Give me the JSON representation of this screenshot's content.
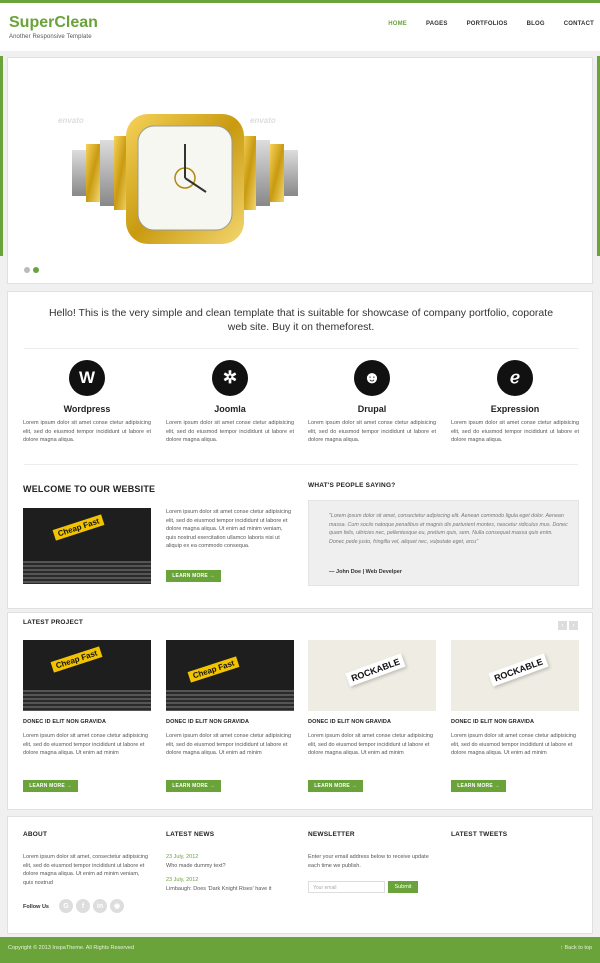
{
  "header": {
    "logo_title": "SuperClean",
    "logo_tagline": "Another Responsive Template",
    "nav": [
      "HOME",
      "PAGES",
      "PORTFOLIOS",
      "BLOG",
      "CONTACT"
    ]
  },
  "slider": {
    "watermarks": [
      "envato",
      "envato"
    ],
    "dots": 2,
    "active_dot": 1
  },
  "intro": "Hello! This is the very simple and clean template that is suitable for showcase of company portfolio, coporate web site. Buy it on themeforest.",
  "features": [
    {
      "title": "Wordpress",
      "icon": "wordpress-icon",
      "glyph": "W",
      "text": "Lorem ipsum dolor sit amet conse ctetur adipisicing elit, sed do eiusmod tempor incididunt ut labore et dolore magna aliqua."
    },
    {
      "title": "Joomla",
      "icon": "joomla-icon",
      "glyph": "✲",
      "text": "Lorem ipsum dolor sit amet conse ctetur adipisicing elit, sed do eiusmod tempor incididunt ut labore et dolore magna aliqua."
    },
    {
      "title": "Drupal",
      "icon": "drupal-icon",
      "glyph": "☻",
      "text": "Lorem ipsum dolor sit amet conse ctetur adipisicing elit, sed do eiusmod tempor incididunt ut labore et dolore magna aliqua."
    },
    {
      "title": "Expression",
      "icon": "expression-engine-icon",
      "glyph": "ℯ",
      "text": "Lorem ipsum dolor sit amet conse ctetur adipisicing elit, sed do eiusmod tempor incididunt ut labore et dolore magna aliqua."
    }
  ],
  "welcome": {
    "heading": "WELCOME TO OUR WEBSITE",
    "image_label": "Cheap Fast",
    "text": "Lorem ipsum dolor sit amet conse ctetur adipisicing elit, sed do eiusmod tempor incididunt ut labore et dolore magna aliqua. Ut enim ad minim veniam, quis nostrud exercitation ullamco laboris nisi ut aliquip ex ea commodo consequa.",
    "button": "LEARN MORE →"
  },
  "testimonial": {
    "heading": "WHAT'S PEOPLE SAYING?",
    "text": "\"Lorem ipsum dolor sit amet, consectetur adipiscing elit. Aenean commodo ligula eget dolor. Aenean massa. Cum sociis natoque penatibus et magnis dis parturient montes, nascetur ridiculus mus. Donec quam felis, ultricies nec, pellentesque eu, pretium quis, sem. Nulla consequat massa quis enim. Donec pede justo, fringilla vel, aliquet nec, vulputate eget, arcu\"",
    "author": "— John Doe | Web Develper"
  },
  "latest_project": {
    "heading": "LATEST PROJECT",
    "arrows": [
      "‹",
      "›"
    ],
    "items": [
      {
        "title": "DONEC ID ELIT NON GRAVIDA",
        "image": "book",
        "image_label": "Cheap Fast",
        "text": "Lorem ipsum dolor sit amet conse ctetur adipisicing elit, sed do eiusmod tempor incididunt ut labore et dolore magna aliqua. Ut enim ad minim",
        "button": "LEARN MORE →"
      },
      {
        "title": "DONEC ID ELIT NON GRAVIDA",
        "image": "book",
        "image_label": "Cheap Fast",
        "text": "Lorem ipsum dolor sit amet conse ctetur adipisicing elit, sed do eiusmod tempor incididunt ut labore et dolore magna aliqua. Ut enim ad minim",
        "button": "LEARN MORE →"
      },
      {
        "title": "DONEC ID ELIT NON GRAVIDA",
        "image": "card",
        "image_label": "ROCKABLE",
        "text": "Lorem ipsum dolor sit amet conse ctetur adipisicing elit, sed do eiusmod tempor incididunt ut labore et dolore magna aliqua. Ut enim ad minim",
        "button": "LEARN MORE →"
      },
      {
        "title": "DONEC ID ELIT NON GRAVIDA",
        "image": "card",
        "image_label": "ROCKABLE",
        "text": "Lorem ipsum dolor sit amet conse ctetur adipisicing elit, sed do eiusmod tempor incididunt ut labore et dolore magna aliqua. Ut enim ad minim",
        "button": "LEARN MORE →"
      }
    ]
  },
  "footer": {
    "about": {
      "heading": "ABOUT",
      "text": "Lorem ipsum dolor sit amet, consectetur adipisicing elit, sed do eiusmod tempor incididunt ut labore et dolore magna aliqua. Ut enim ad minim veniam, quis nostrud",
      "follow_label": "Follow Us",
      "social": [
        "G",
        "f",
        "in",
        "rss"
      ]
    },
    "news": {
      "heading": "LATEST NEWS",
      "items": [
        {
          "date": "23 July, 2012",
          "text": "Who made dummy text?"
        },
        {
          "date": "23 July, 2012",
          "text": "Limbaugh: Does 'Dark Knight Rises' have it"
        }
      ]
    },
    "newsletter": {
      "heading": "NEWSLETTER",
      "text": "Enter your email address below to receive update each time we publish.",
      "placeholder": "Your email",
      "button": "Submit"
    },
    "tweets": {
      "heading": "LATEST TWEETS"
    }
  },
  "bottom": {
    "copyright": "Copyright © 2013 InspaTheme. All Rights Reserved",
    "back_to_top": "↑ Back to top"
  },
  "colors": {
    "accent": "#6aa33a",
    "gold": "#d4a11a"
  }
}
